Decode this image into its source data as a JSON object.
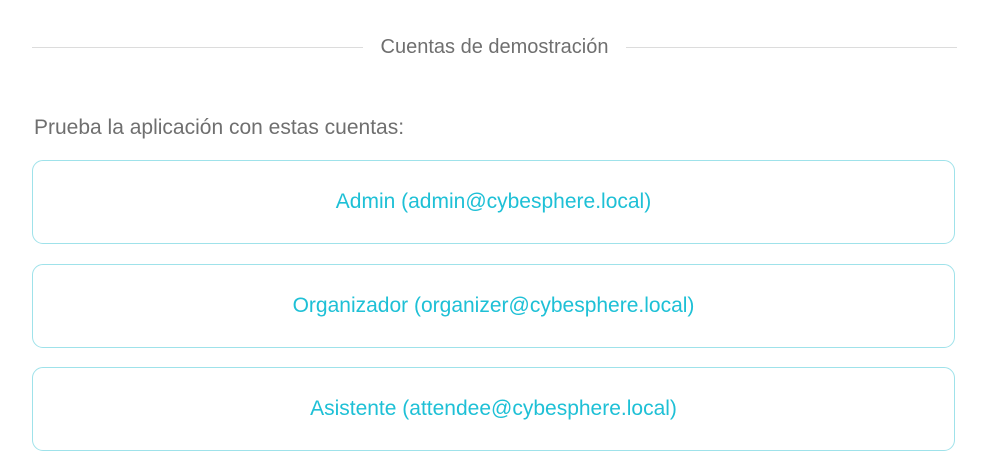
{
  "section": {
    "divider_label": "Cuentas de demostración",
    "intro_text": "Prueba la aplicación con estas cuentas:"
  },
  "accounts": [
    {
      "label": "Admin (admin@cybesphere.local)"
    },
    {
      "label": "Organizador (organizer@cybesphere.local)"
    },
    {
      "label": "Asistente (attendee@cybesphere.local)"
    }
  ],
  "colors": {
    "accent_text": "#1ec0d6",
    "button_border": "#9fe2ea",
    "muted_text": "#6f6f6f",
    "divider_line": "#dcdcdc"
  }
}
